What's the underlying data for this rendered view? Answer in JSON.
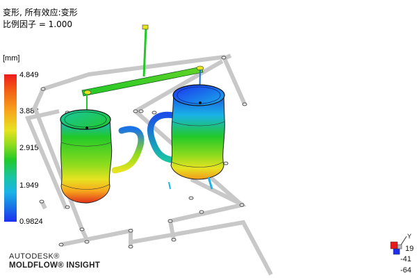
{
  "title_line1": "变形, 所有效应:变形",
  "title_line2": "比例因子 = 1.000",
  "legend": {
    "units": "[mm]",
    "ticks": [
      "4.849",
      "3.882",
      "2.915",
      "1.949",
      "0.9824"
    ],
    "colors": [
      "#ee1b1b",
      "#f7a61c",
      "#e6e321",
      "#22c929",
      "#19b3e6",
      "#1c2ff0"
    ]
  },
  "logo": {
    "line1": "AUTODESK®",
    "line2": "MOLDFLOW® INSIGHT"
  },
  "axis_triad": {
    "v1": "19",
    "v2": "-41",
    "v3": "-64"
  }
}
